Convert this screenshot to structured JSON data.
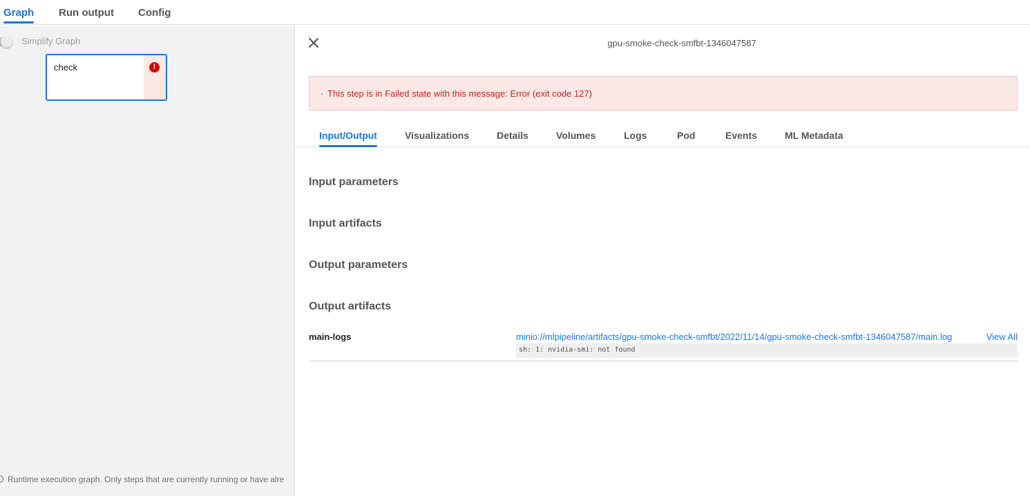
{
  "top_tabs": [
    {
      "label": "Graph",
      "active": true
    },
    {
      "label": "Run output",
      "active": false
    },
    {
      "label": "Config",
      "active": false
    }
  ],
  "graph": {
    "simplify_label": "Simplify Graph",
    "simplify_enabled": false,
    "node": {
      "label": "check",
      "status": "failed",
      "status_icon": "error-icon"
    },
    "footer_note": "Runtime execution graph. Only steps that are currently running or have alre"
  },
  "details": {
    "title": "gpu-smoke-check-smfbt-1346047587",
    "close_icon": "close-icon",
    "error_bullet": "·",
    "error_message": "This step is in Failed state with this message: Error (exit code 127)",
    "tabs": [
      {
        "label": "Input/Output",
        "active": true
      },
      {
        "label": "Visualizations",
        "active": false
      },
      {
        "label": "Details",
        "active": false
      },
      {
        "label": "Volumes",
        "active": false
      },
      {
        "label": "Logs",
        "active": false
      },
      {
        "label": "Pod",
        "active": false
      },
      {
        "label": "Events",
        "active": false
      },
      {
        "label": "ML Metadata",
        "active": false
      }
    ],
    "sections": {
      "input_parameters": "Input parameters",
      "input_artifacts": "Input artifacts",
      "output_parameters": "Output parameters",
      "output_artifacts": "Output artifacts"
    },
    "artifact": {
      "name": "main-logs",
      "uri": "minio://mlpipeline/artifacts/gpu-smoke-check-smfbt/2022/11/14/gpu-smoke-check-smfbt-1346047587/main.log",
      "view_all": "View All",
      "preview": "sh: 1: nvidia-smi: not found"
    }
  },
  "colors": {
    "accent": "#1a73e8",
    "error": "#c5221f",
    "error_bg": "#fce8e6",
    "error_icon": "#d50000",
    "graph_bg": "#f2f2f2"
  }
}
